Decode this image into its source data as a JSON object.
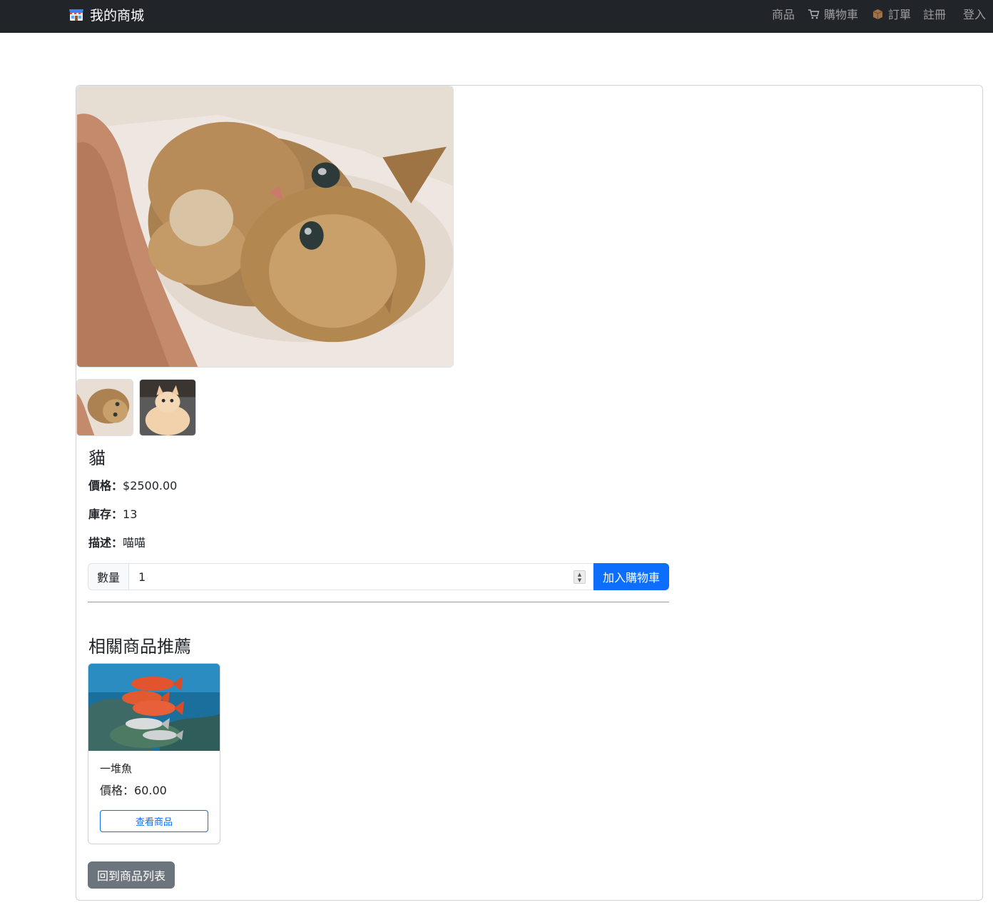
{
  "navbar": {
    "brand": "我的商城",
    "brand_icon": "store-icon",
    "links": {
      "products": "商品",
      "cart": "購物車",
      "orders": "訂單",
      "register": "註冊",
      "login": "登入"
    },
    "icons": {
      "cart": "shopping-cart-icon",
      "orders": "package-box-icon"
    },
    "background": "#212529"
  },
  "product": {
    "name": "貓",
    "price_label": "價格：",
    "price": "$2500.00",
    "stock_label": "庫存：",
    "stock": "13",
    "desc_label": "描述：",
    "desc": "喵喵",
    "image_main": "lying-tabby-cat-photo",
    "thumbnails": [
      "lying-tabby-cat-thumbnail",
      "cream-cat-thumbnail"
    ]
  },
  "quantity": {
    "label": "數量",
    "value": "1",
    "add_to_cart": "加入購物車"
  },
  "related": {
    "title": "相關商品推薦",
    "items": [
      {
        "name": "一堆魚",
        "price_label": "價格：",
        "price": "60.00",
        "view_button": "查看商品",
        "image": "red-fish-school-photo"
      }
    ]
  },
  "back_button": "回到商品列表",
  "colors": {
    "primary": "#0d6efd",
    "secondary": "#6c757d",
    "dark": "#212529"
  }
}
